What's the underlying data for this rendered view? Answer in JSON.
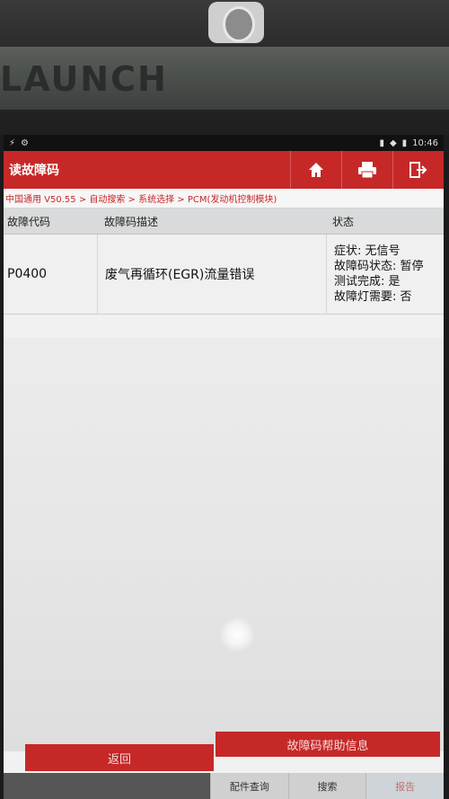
{
  "device": {
    "brand": "LAUNCH"
  },
  "statusbar": {
    "left_icons": [
      "usb-icon",
      "settings-icon"
    ],
    "time": "10:46"
  },
  "titlebar": {
    "title": "读故障码"
  },
  "breadcrumb": "中国通用 V50.55 > 自动搜索 > 系统选择 > PCM(发动机控制模块)",
  "table": {
    "headers": [
      "故障代码",
      "故障码描述",
      "状态"
    ],
    "rows": [
      {
        "code": "P0400",
        "description": "废气再循环(EGR)流量错误",
        "status": [
          "症状: 无信号",
          "故障码状态: 暂停",
          "测试完成: 是",
          "故障灯需要: 否"
        ]
      }
    ]
  },
  "buttons": {
    "back": "返回",
    "help": "故障码帮助信息"
  },
  "bottom_tabs": [
    "配件查询",
    "搜索",
    "报告"
  ]
}
